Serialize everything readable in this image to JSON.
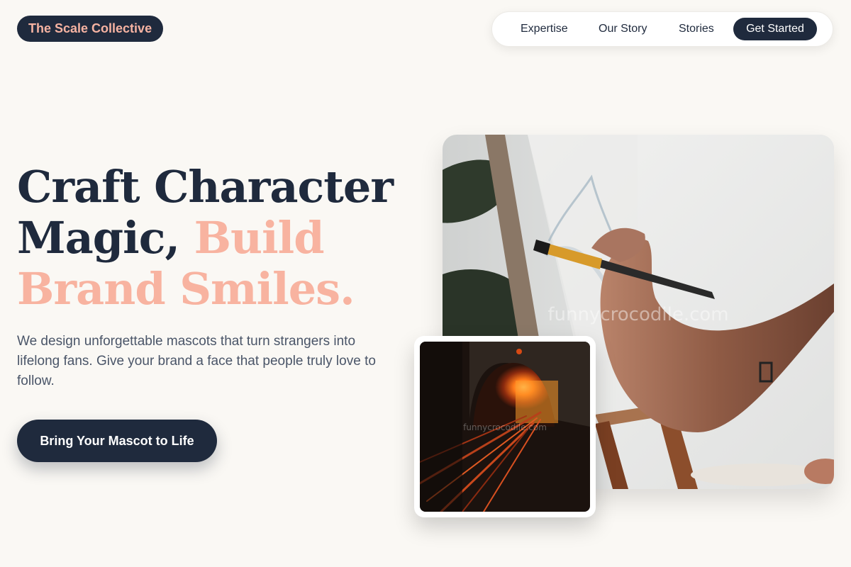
{
  "header": {
    "brand": "The Scale Collective",
    "nav": {
      "items": [
        "Expertise",
        "Our Story",
        "Stories"
      ],
      "cta": "Get Started"
    }
  },
  "hero": {
    "headline": {
      "line1": "Craft Character",
      "line2_dark": "Magic, ",
      "line2_accent": "Build",
      "line3_accent": "Brand Smiles."
    },
    "subtitle": "We design unforgettable mascots that turn strangers into lifelong fans. Give your brand a face that people truly love to follow.",
    "cta": "Bring Your Mascot to Life"
  },
  "images": {
    "main_watermark": "funnycrocodile.com",
    "inset_watermark": "funnycrocodile.com"
  },
  "colors": {
    "background": "#faf8f4",
    "navy": "#1f2a3d",
    "accent_peach": "#f8b3a0",
    "body_text": "#4a5568"
  }
}
